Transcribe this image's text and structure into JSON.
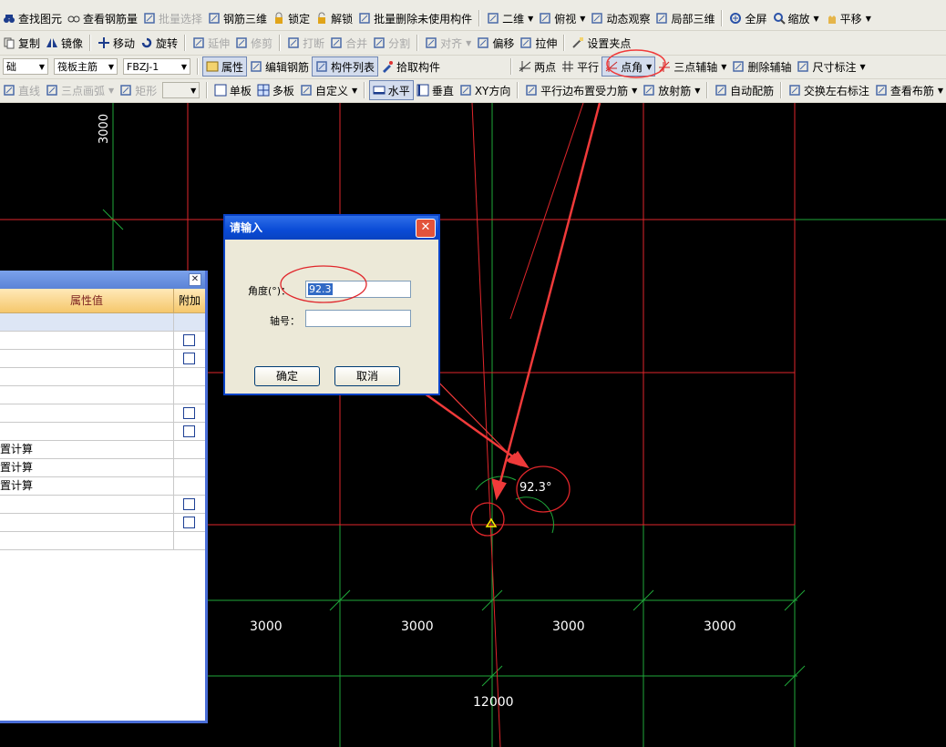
{
  "toolbar_row1": [
    {
      "label": "查找图元",
      "icon": "binoculars-icon"
    },
    {
      "label": "查看钢筋量",
      "icon": "glasses-icon"
    },
    {
      "label": "批量选择",
      "icon": "batch-select-icon",
      "disabled": true
    },
    {
      "label": "钢筋三维",
      "icon": "rebar-3d-icon"
    },
    {
      "label": "锁定",
      "icon": "lock-icon"
    },
    {
      "label": "解锁",
      "icon": "unlock-icon"
    },
    {
      "label": "批量删除未使用构件",
      "icon": "brush-icon"
    },
    {
      "label": "二维",
      "icon": "2d-view-icon",
      "dropdown": true
    },
    {
      "label": "俯视",
      "icon": "top-view-icon",
      "dropdown": true
    },
    {
      "label": "动态观察",
      "icon": "orbit-icon"
    },
    {
      "label": "局部三维",
      "icon": "partial-3d-icon"
    },
    {
      "label": "全屏",
      "icon": "fullscreen-icon"
    },
    {
      "label": "缩放",
      "icon": "zoom-icon",
      "dropdown": true
    },
    {
      "label": "平移",
      "icon": "pan-icon",
      "dropdown": true
    }
  ],
  "toolbar_row2": [
    {
      "label": "复制",
      "icon": "copy-icon"
    },
    {
      "label": "镜像",
      "icon": "mirror-icon"
    },
    {
      "label": "移动",
      "icon": "move-icon"
    },
    {
      "label": "旋转",
      "icon": "rotate-icon"
    },
    {
      "label": "延伸",
      "icon": "extend-icon",
      "disabled": true
    },
    {
      "label": "修剪",
      "icon": "trim-icon",
      "disabled": true
    },
    {
      "label": "打断",
      "icon": "break-icon",
      "disabled": true
    },
    {
      "label": "合并",
      "icon": "merge-icon",
      "disabled": true
    },
    {
      "label": "分割",
      "icon": "split-icon",
      "disabled": true
    },
    {
      "label": "对齐",
      "icon": "align-icon",
      "disabled": true,
      "dropdown": true
    },
    {
      "label": "偏移",
      "icon": "offset-icon"
    },
    {
      "label": "拉伸",
      "icon": "stretch-icon"
    },
    {
      "label": "设置夹点",
      "icon": "grip-point-icon"
    }
  ],
  "toolbar_row3": {
    "combo1": "础",
    "combo2": "筏板主筋",
    "combo3": "FBZJ-1",
    "buttons_left": [
      {
        "label": "属性",
        "icon": "properties-icon",
        "pressed": true
      },
      {
        "label": "编辑钢筋",
        "icon": "edit-rebar-icon"
      },
      {
        "label": "构件列表",
        "icon": "component-list-icon",
        "pressed": true
      },
      {
        "label": "拾取构件",
        "icon": "eyedropper-icon"
      }
    ],
    "buttons_right": [
      {
        "label": "两点",
        "icon": "two-point-axis-icon"
      },
      {
        "label": "平行",
        "icon": "parallel-axis-icon"
      },
      {
        "label": "点角",
        "icon": "point-angle-axis-icon",
        "highlighted": true,
        "dropdown": true
      },
      {
        "label": "三点辅轴",
        "icon": "three-point-axis-icon",
        "dropdown": true
      },
      {
        "label": "删除辅轴",
        "icon": "delete-axis-icon"
      },
      {
        "label": "尺寸标注",
        "icon": "dimension-icon",
        "dropdown": true
      }
    ]
  },
  "toolbar_row4": [
    {
      "label": "直线",
      "icon": "line-icon",
      "disabled": true
    },
    {
      "label": "三点画弧",
      "icon": "arc-icon",
      "disabled": true,
      "dropdown": true
    },
    {
      "label": "矩形",
      "icon": "rectangle-icon",
      "disabled": true
    },
    {
      "label": "单板",
      "icon": "single-slab-icon"
    },
    {
      "label": "多板",
      "icon": "multi-slab-icon"
    },
    {
      "label": "自定义",
      "icon": "custom-icon",
      "dropdown": true
    },
    {
      "label": "水平",
      "icon": "horizontal-icon",
      "pressed": true
    },
    {
      "label": "垂直",
      "icon": "vertical-icon"
    },
    {
      "label": "XY方向",
      "icon": "xy-direction-icon"
    },
    {
      "label": "平行边布置受力筋",
      "icon": "parallel-edge-icon",
      "dropdown": true
    },
    {
      "label": "放射筋",
      "icon": "radial-rebar-icon",
      "dropdown": true
    },
    {
      "label": "自动配筋",
      "icon": "auto-rebar-icon"
    },
    {
      "label": "交换左右标注",
      "icon": "swap-label-icon"
    },
    {
      "label": "查看布筋",
      "icon": "view-rebar-icon",
      "dropdown": true
    }
  ],
  "canvas": {
    "dim_top_left": "3000",
    "dim_bottom": [
      "3000",
      "3000",
      "3000",
      "3000"
    ],
    "dim_total": "12000",
    "angle_label": "92.3°"
  },
  "panel": {
    "header_value": "属性值",
    "header_add": "附加",
    "rows": [
      {
        "value": "",
        "checkbox": false,
        "blue": true
      },
      {
        "value": "",
        "checkbox": true
      },
      {
        "value": "",
        "checkbox": true
      },
      {
        "value": "",
        "checkbox": false
      },
      {
        "value": "",
        "checkbox": false
      },
      {
        "value": "",
        "checkbox": true
      },
      {
        "value": "",
        "checkbox": true
      },
      {
        "value": "置计算",
        "checkbox": false
      },
      {
        "value": "置计算",
        "checkbox": false
      },
      {
        "value": "置计算",
        "checkbox": false
      },
      {
        "value": "",
        "checkbox": true
      },
      {
        "value": "",
        "checkbox": true
      },
      {
        "value": "",
        "checkbox": false
      }
    ]
  },
  "dialog": {
    "title": "请输入",
    "angle_label": "角度(°)：",
    "angle_value": "92.3",
    "axis_label": "轴号：",
    "axis_value": "",
    "ok": "确定",
    "cancel": "取消"
  },
  "colors": {
    "grid_red": "#e0262b",
    "grid_green": "#1fa83a",
    "annotation_red": "#f03a3a",
    "dialog_title_blue": "#0a4bd6"
  }
}
